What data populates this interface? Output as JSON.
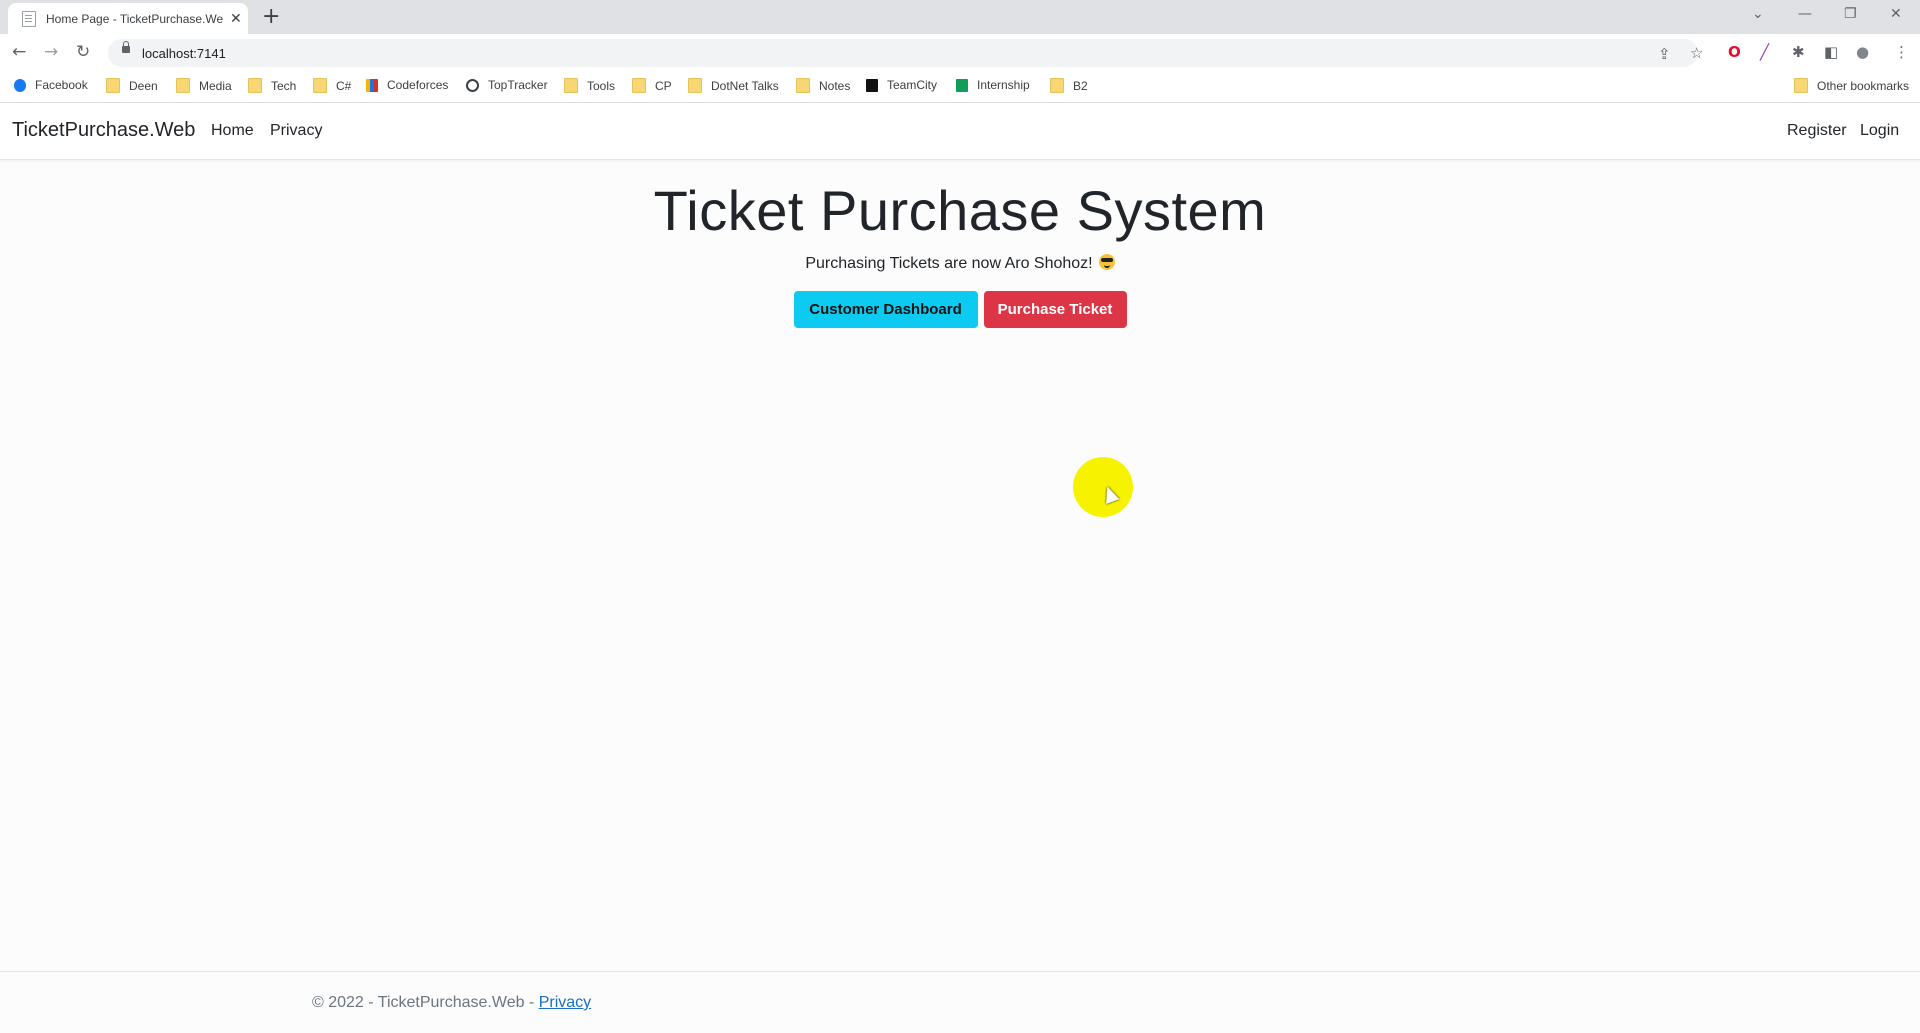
{
  "browser": {
    "tab_title": "Home Page - TicketPurchase.Web",
    "tab_close": "✕",
    "new_tab": "+",
    "url": "localhost:7141",
    "bookmarks": [
      {
        "label": "Facebook",
        "icon": "facebook-icon"
      },
      {
        "label": "Deen",
        "icon": "folder-icon"
      },
      {
        "label": "Media",
        "icon": "folder-icon"
      },
      {
        "label": "Tech",
        "icon": "folder-icon"
      },
      {
        "label": "C#",
        "icon": "folder-icon"
      },
      {
        "label": "Codeforces",
        "icon": "codeforces-icon"
      },
      {
        "label": "TopTracker",
        "icon": "toptracker-icon"
      },
      {
        "label": "Tools",
        "icon": "folder-icon"
      },
      {
        "label": "CP",
        "icon": "folder-icon"
      },
      {
        "label": "DotNet Talks",
        "icon": "folder-icon"
      },
      {
        "label": "Notes",
        "icon": "folder-icon"
      },
      {
        "label": "TeamCity",
        "icon": "teamcity-icon"
      },
      {
        "label": "Internship",
        "icon": "sheets-icon"
      },
      {
        "label": "B2",
        "icon": "folder-icon"
      }
    ],
    "other_bookmarks": "Other bookmarks"
  },
  "site": {
    "brand": "TicketPurchase.Web",
    "nav_left": [
      "Home",
      "Privacy"
    ],
    "nav_right": [
      "Register",
      "Login"
    ]
  },
  "hero": {
    "title": "Ticket Purchase System",
    "lead": "Purchasing Tickets are now Aro Shohoz!",
    "buttons": {
      "customer_dashboard": "Customer Dashboard",
      "purchase_ticket": "Purchase Ticket"
    }
  },
  "footer": {
    "text": "© 2022 - TicketPurchase.Web - ",
    "link": "Privacy"
  },
  "colors": {
    "info_button": "#0dcaf0",
    "danger_button": "#dc3545",
    "cursor_highlight": "#f7f300"
  }
}
